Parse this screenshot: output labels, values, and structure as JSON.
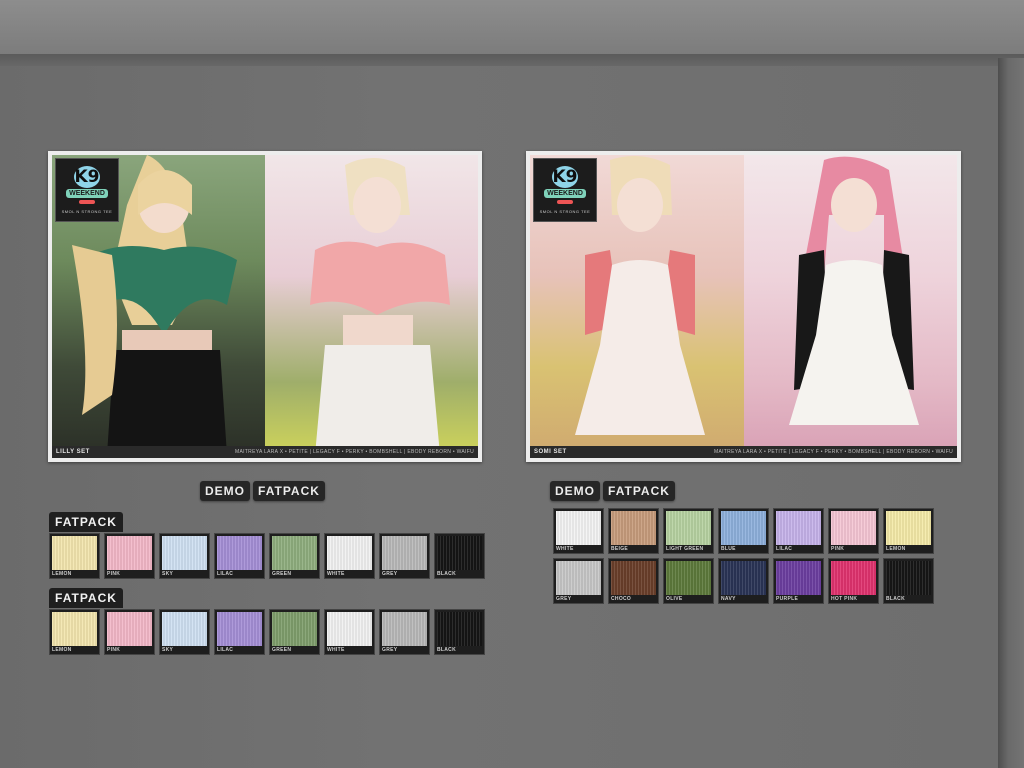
{
  "left_display": {
    "poster": {
      "logo": {
        "brand": "K9",
        "sub": "WEEKEND",
        "small": "SMOL N STRONG TEE"
      },
      "set_name": "LILLY SET",
      "bodies": "MAITREYA LARA X • PETITE | LEGACY F • PERKY • BOMBSHELL | EBODY REBORN • WAIFU"
    },
    "buttons": {
      "demo": "DEMO",
      "fatpack": "FATPACK"
    },
    "groups": [
      {
        "label": "FATPACK",
        "swatches": [
          {
            "name": "LEMON",
            "color": "#f3e6ae"
          },
          {
            "name": "PINK",
            "color": "#f3b8c8"
          },
          {
            "name": "SKY",
            "color": "#cfe0f2"
          },
          {
            "name": "LILAC",
            "color": "#a58fd6"
          },
          {
            "name": "GREEN",
            "color": "#8fae7e"
          },
          {
            "name": "WHITE",
            "color": "#f1f1f1"
          },
          {
            "name": "GREY",
            "color": "#b9b9b9"
          },
          {
            "name": "BLACK",
            "color": "#151515"
          }
        ]
      },
      {
        "label": "FATPACK",
        "swatches": [
          {
            "name": "LEMON",
            "color": "#f3e6ae"
          },
          {
            "name": "PINK",
            "color": "#f3b8c8"
          },
          {
            "name": "SKY",
            "color": "#cfe0f2"
          },
          {
            "name": "LILAC",
            "color": "#a58fd6"
          },
          {
            "name": "GREEN",
            "color": "#7f9e6c"
          },
          {
            "name": "WHITE",
            "color": "#f1f1f1"
          },
          {
            "name": "GREY",
            "color": "#b9b9b9"
          },
          {
            "name": "BLACK",
            "color": "#151515"
          }
        ]
      }
    ]
  },
  "right_display": {
    "poster": {
      "logo": {
        "brand": "K9",
        "sub": "WEEKEND",
        "small": "SMOL N STRONG TEE"
      },
      "set_name": "SOMI SET",
      "bodies": "MAITREYA LARA X • PETITE | LEGACY F • PERKY • BOMBSHELL | EBODY REBORN • WAIFU"
    },
    "buttons": {
      "demo": "DEMO",
      "fatpack": "FATPACK"
    },
    "rows": [
      [
        {
          "name": "WHITE",
          "color": "#f3f3f3"
        },
        {
          "name": "BEIGE",
          "color": "#c79c7c"
        },
        {
          "name": "LIGHT GREEN",
          "color": "#b7d2a2"
        },
        {
          "name": "BLUE",
          "color": "#8eb0dc"
        },
        {
          "name": "LILAC",
          "color": "#c6b3ea"
        },
        {
          "name": "PINK",
          "color": "#f5c6d4"
        },
        {
          "name": "LEMON",
          "color": "#f4eaa8"
        }
      ],
      [
        {
          "name": "GREY",
          "color": "#c7c7c7"
        },
        {
          "name": "CHOCO",
          "color": "#6a3f2a"
        },
        {
          "name": "OLIVE",
          "color": "#5d7a3c"
        },
        {
          "name": "NAVY",
          "color": "#2a3456"
        },
        {
          "name": "PURPLE",
          "color": "#6c3fa0"
        },
        {
          "name": "HOT PINK",
          "color": "#e0336f"
        },
        {
          "name": "BLACK",
          "color": "#161616"
        }
      ]
    ]
  }
}
